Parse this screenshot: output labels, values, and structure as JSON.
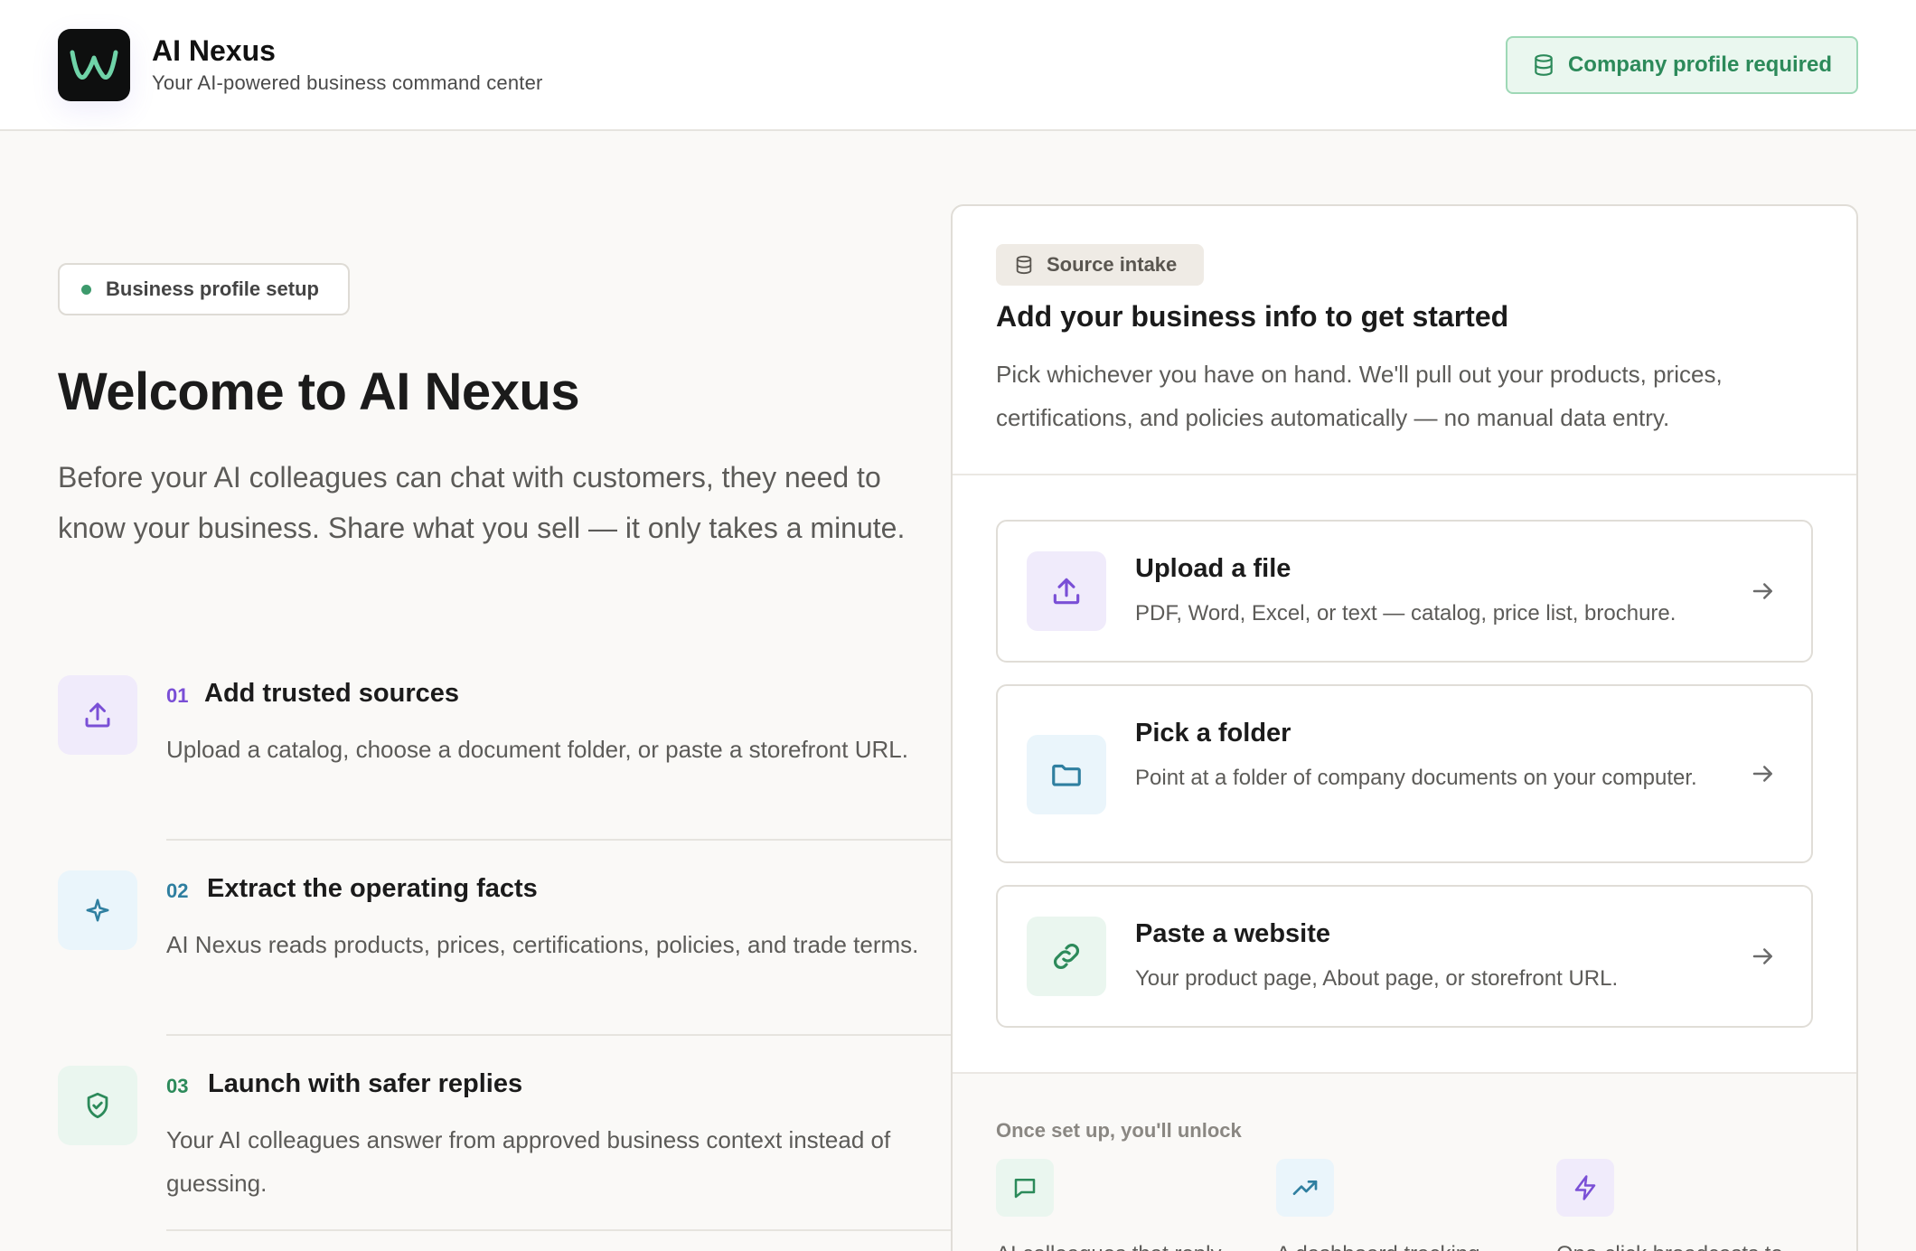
{
  "header": {
    "app_title": "AI Nexus",
    "app_subtitle": "Your AI-powered business command center",
    "profile_button": "Company profile required"
  },
  "left": {
    "badge": "Business profile setup",
    "welcome_title": "Welcome to AI Nexus",
    "intro": "Before your AI colleagues can chat with customers, they need to know your business. Share what you sell — it only takes a minute.",
    "steps": [
      {
        "num": "01",
        "title": "Add trusted sources",
        "desc": "Upload a catalog, choose a document folder, or paste a storefront URL.",
        "icon": "upload-icon"
      },
      {
        "num": "02",
        "title": "Extract the operating facts",
        "desc": "AI Nexus reads products, prices, certifications, policies, and trade terms.",
        "icon": "sparkle-icon"
      },
      {
        "num": "03",
        "title": "Launch with safer replies",
        "desc": "Your AI colleagues answer from approved business context instead of guessing.",
        "icon": "shield-check-icon"
      }
    ]
  },
  "card": {
    "badge": "Source intake",
    "title": "Add your business info to get started",
    "desc": "Pick whichever you have on hand. We'll pull out your products, prices, certifications, and policies automatically — no manual data entry.",
    "options": [
      {
        "title": "Upload a file",
        "desc": "PDF, Word, Excel, or text — catalog, price list, brochure.",
        "icon": "upload-icon"
      },
      {
        "title": "Pick a folder",
        "desc": "Point at a folder of company documents on your computer.",
        "icon": "folder-icon"
      },
      {
        "title": "Paste a website",
        "desc": "Your product page, About page, or storefront URL.",
        "icon": "link-icon"
      }
    ],
    "unlock_label": "Once set up, you'll unlock",
    "unlocks": [
      {
        "text": "AI colleagues that reply",
        "icon": "chat-icon"
      },
      {
        "text": "A dashboard tracking",
        "icon": "trend-icon"
      },
      {
        "text": "One-click broadcasts to",
        "icon": "bolt-icon"
      }
    ]
  },
  "colors": {
    "purple": "#7a4fd6",
    "teal": "#2f7fa0",
    "green": "#2c8a5a",
    "accent_logo": "#6fd3a8"
  }
}
